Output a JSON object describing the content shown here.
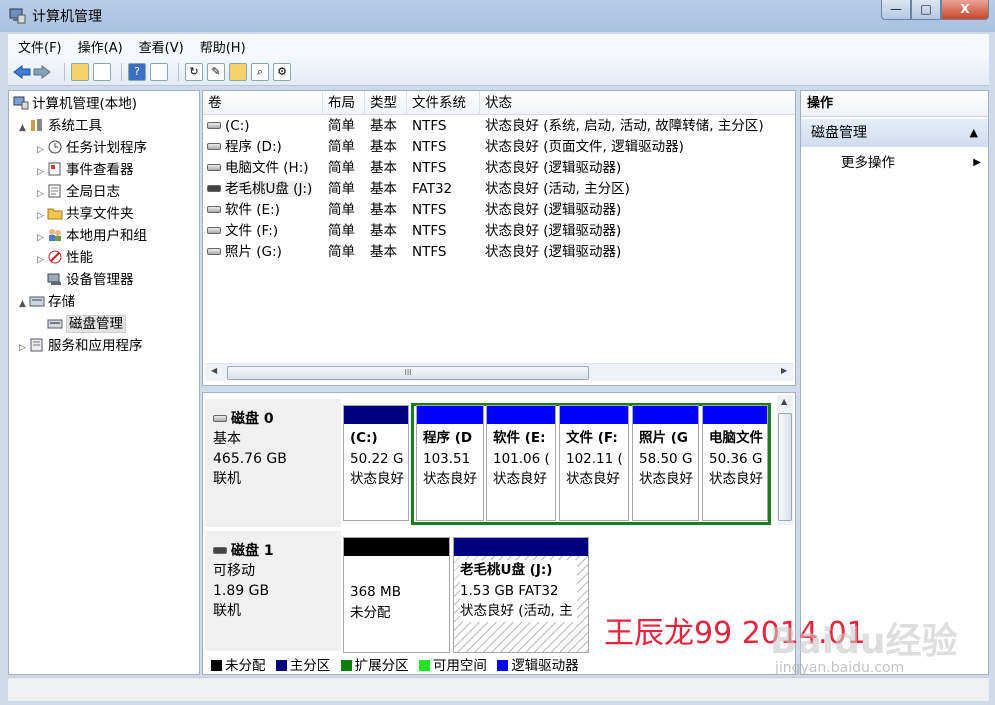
{
  "window": {
    "title": "计算机管理"
  },
  "window_buttons": {
    "minimize": "—",
    "maximize": "□",
    "close": "X"
  },
  "menu": [
    "文件(F)",
    "操作(A)",
    "查看(V)",
    "帮助(H)"
  ],
  "tree": [
    {
      "label": "计算机管理(本地)",
      "icon": "computer-icon",
      "level": 0
    },
    {
      "label": "系统工具",
      "icon": "tools-icon",
      "level": 1,
      "arrow": "▲"
    },
    {
      "label": "任务计划程序",
      "icon": "clock-icon",
      "level": 2,
      "arrow": "▷"
    },
    {
      "label": "事件查看器",
      "icon": "event-viewer-icon",
      "level": 2,
      "arrow": "▷"
    },
    {
      "label": "全局日志",
      "icon": "log-icon",
      "level": 2,
      "arrow": "▷"
    },
    {
      "label": "共享文件夹",
      "icon": "shared-folder-icon",
      "level": 2,
      "arrow": "▷"
    },
    {
      "label": "本地用户和组",
      "icon": "users-icon",
      "level": 2,
      "arrow": "▷"
    },
    {
      "label": "性能",
      "icon": "performance-icon",
      "level": 2,
      "arrow": "▷"
    },
    {
      "label": "设备管理器",
      "icon": "device-manager-icon",
      "level": 2,
      "arrow": ""
    },
    {
      "label": "存储",
      "icon": "storage-icon",
      "level": 1,
      "arrow": "▲"
    },
    {
      "label": "磁盘管理",
      "icon": "disk-management-icon",
      "level": 2,
      "arrow": "",
      "selected": true
    },
    {
      "label": "服务和应用程序",
      "icon": "services-icon",
      "level": 1,
      "arrow": "▷"
    }
  ],
  "volumes": {
    "columns": [
      "卷",
      "布局",
      "类型",
      "文件系统",
      "状态"
    ],
    "rows": [
      [
        "(C:)",
        "简单",
        "基本",
        "NTFS",
        "状态良好 (系统, 启动, 活动, 故障转储, 主分区)"
      ],
      [
        "程序 (D:)",
        "简单",
        "基本",
        "NTFS",
        "状态良好 (页面文件, 逻辑驱动器)"
      ],
      [
        "电脑文件 (H:)",
        "简单",
        "基本",
        "NTFS",
        "状态良好 (逻辑驱动器)"
      ],
      [
        "老毛桃U盘 (J:)",
        "简单",
        "基本",
        "FAT32",
        "状态良好 (活动, 主分区)"
      ],
      [
        "软件 (E:)",
        "简单",
        "基本",
        "NTFS",
        "状态良好 (逻辑驱动器)"
      ],
      [
        "文件 (F:)",
        "简单",
        "基本",
        "NTFS",
        "状态良好 (逻辑驱动器)"
      ],
      [
        "照片 (G:)",
        "简单",
        "基本",
        "NTFS",
        "状态良好 (逻辑驱动器)"
      ]
    ],
    "scroll_grip": "III"
  },
  "disks": [
    {
      "name": "磁盘 0",
      "type": "基本",
      "size": "465.76 GB",
      "state": "联机",
      "partitions": [
        {
          "name": "(C:)",
          "size": "50.22 G",
          "status": "状态良好",
          "kind": "primary"
        },
        {
          "name": "程序 (D",
          "size": "103.51",
          "status": "状态良好",
          "kind": "logical"
        },
        {
          "name": "软件 (E:",
          "size": "101.06 (",
          "status": "状态良好",
          "kind": "logical"
        },
        {
          "name": "文件 (F:",
          "size": "102.11 (",
          "status": "状态良好",
          "kind": "logical"
        },
        {
          "name": "照片 (G",
          "size": "58.50 G",
          "status": "状态良好",
          "kind": "logical"
        },
        {
          "name": "电脑文件",
          "size": "50.36 G",
          "status": "状态良好",
          "kind": "logical"
        }
      ]
    },
    {
      "name": "磁盘 1",
      "type": "可移动",
      "size": "1.89 GB",
      "state": "联机",
      "partitions": [
        {
          "name": "",
          "size": "368 MB",
          "status": "未分配",
          "kind": "unallocated"
        },
        {
          "name": "老毛桃U盘  (J:)",
          "size": "1.53 GB FAT32",
          "status": "状态良好 (活动, 主",
          "kind": "primary"
        }
      ]
    }
  ],
  "legend": [
    {
      "label": "未分配",
      "color": "#000000"
    },
    {
      "label": "主分区",
      "color": "#00007f"
    },
    {
      "label": "扩展分区",
      "color": "#0a7f0a"
    },
    {
      "label": "可用空间",
      "color": "#21e321"
    },
    {
      "label": "逻辑驱动器",
      "color": "#0000ff"
    }
  ],
  "actions": {
    "header": "操作",
    "section": "磁盘管理",
    "section_arrow": "▲",
    "more": "更多操作",
    "more_arrow": "▶"
  },
  "watermark": {
    "signature": "王辰龙99 2014.01",
    "site": "Baidu经验",
    "url": "jingyan.baidu.com"
  },
  "colors": {
    "primary": "#00007f",
    "logical": "#0000ff",
    "unallocated": "#000000",
    "extended_frame": "#1e7b1e"
  }
}
